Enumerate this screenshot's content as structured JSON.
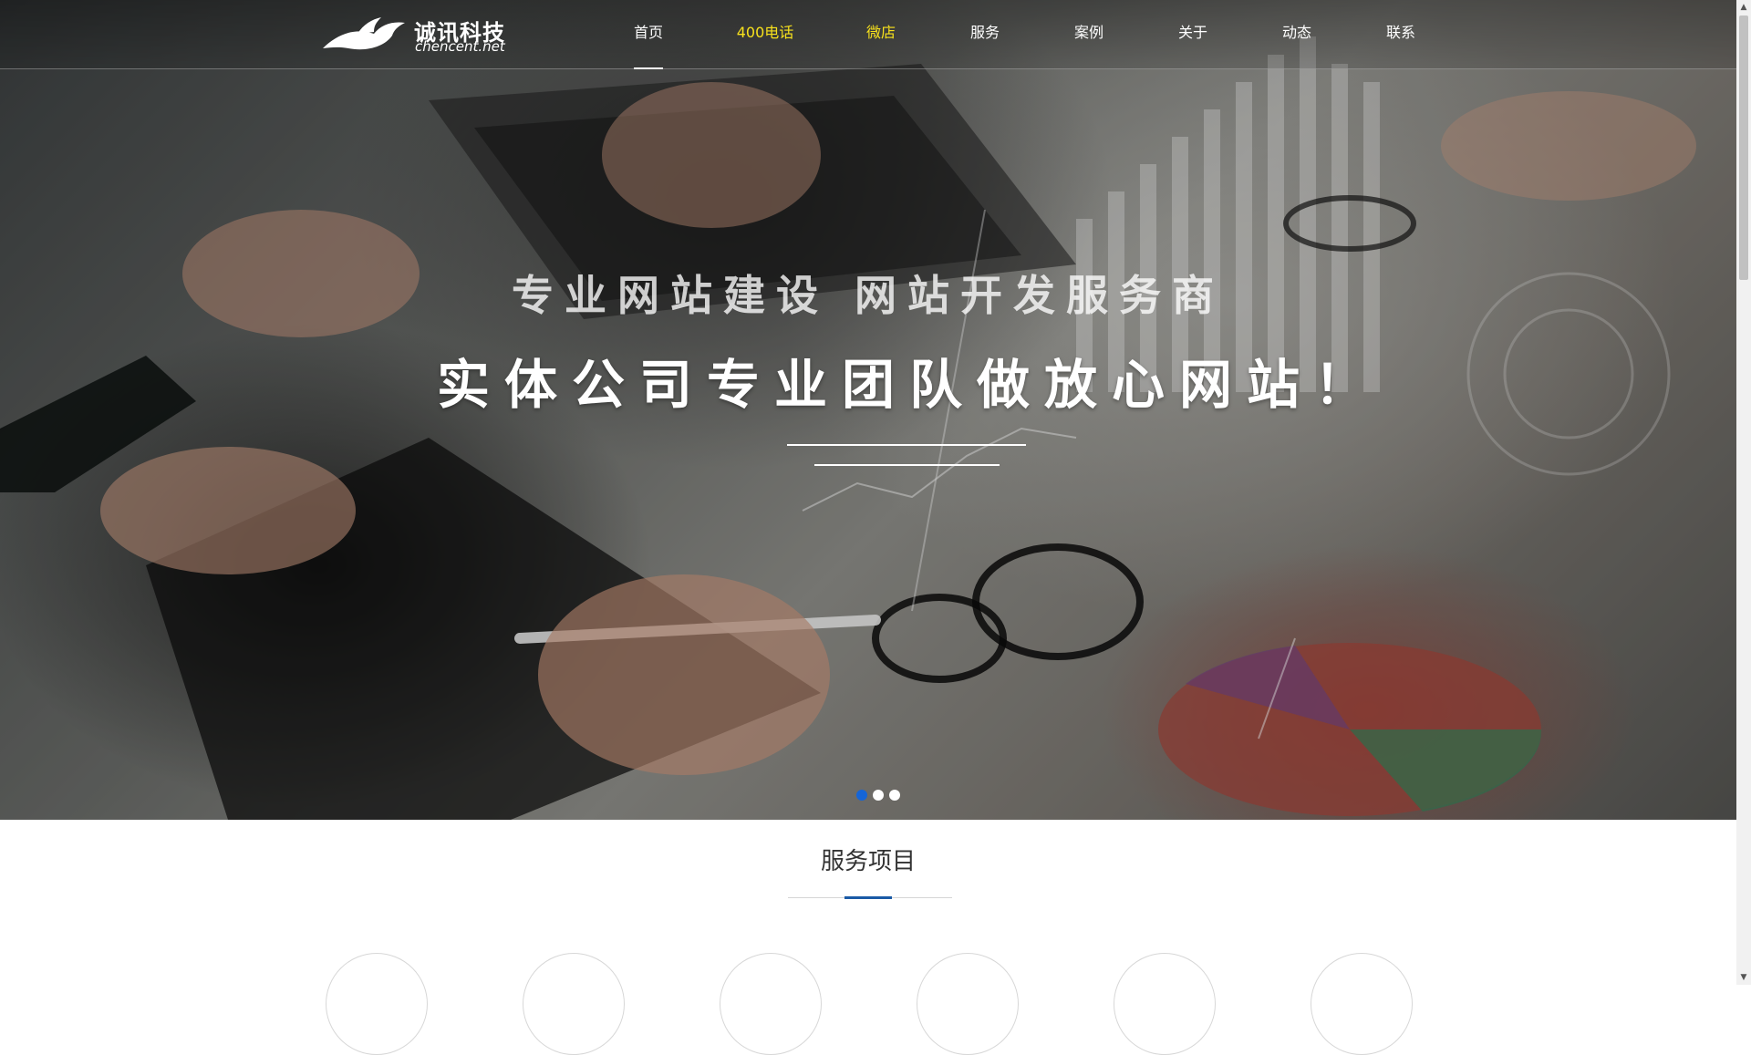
{
  "brand": {
    "name_cn": "诚讯科技",
    "name_en": "chencent.net"
  },
  "nav": {
    "items": [
      {
        "label": "首页",
        "active": true,
        "highlight": false
      },
      {
        "label": "400电话",
        "active": false,
        "highlight": true
      },
      {
        "label": "微店",
        "active": false,
        "highlight": true
      },
      {
        "label": "服务",
        "active": false,
        "highlight": false
      },
      {
        "label": "案例",
        "active": false,
        "highlight": false
      },
      {
        "label": "关于",
        "active": false,
        "highlight": false
      },
      {
        "label": "动态",
        "active": false,
        "highlight": false
      },
      {
        "label": "联系",
        "active": false,
        "highlight": false
      }
    ],
    "highlight_color": "#f7e11c"
  },
  "hero": {
    "subtitle": "专业网站建设   网站开发服务商",
    "headline": "实体公司专业团队做放心网站！",
    "slides": {
      "count": 3,
      "current": 1
    },
    "active_dot_color": "#1565d8"
  },
  "services": {
    "title": "服务项目",
    "accent_color": "#1a5aa6"
  }
}
